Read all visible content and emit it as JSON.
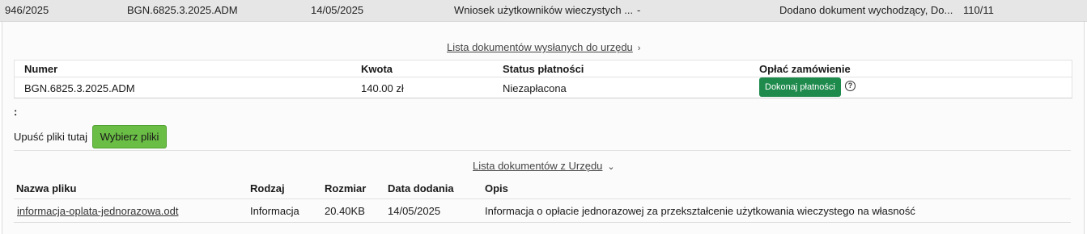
{
  "summary_row": {
    "case_number": "946/2025",
    "reference": "BGN.6825.3.2025.ADM",
    "date": "14/05/2025",
    "subject": "Wniosek użytkowników wieczystych ...",
    "dash": "-",
    "last_event": "Dodano dokument wychodzący, Do...",
    "counter": "110/11"
  },
  "sent_docs_link": "Lista dokumentów wysłanych do urzędu",
  "payments": {
    "headers": [
      "Numer",
      "Kwota",
      "Status płatności",
      "Opłać zamówienie"
    ],
    "rows": [
      {
        "number": "BGN.6825.3.2025.ADM",
        "amount": "140.00 zł",
        "status": "Niezapłacona",
        "pay_button": "Dokonaj płatności"
      }
    ],
    "help_icon": "question-circle-icon"
  },
  "colon_label": ":",
  "upload": {
    "drop_label": "Upuść pliki tutaj",
    "choose_button": "Wybierz pliki"
  },
  "office_docs_link": "Lista dokumentów z Urzędu",
  "office_docs": {
    "headers": [
      "Nazwa pliku",
      "Rodzaj",
      "Rozmiar",
      "Data dodania",
      "Opis"
    ],
    "rows": [
      {
        "file_name": "informacja-oplata-jednorazowa.odt",
        "type": "Informacja",
        "size": "20.40KB",
        "date_added": "14/05/2025",
        "description": "Informacja o opłacie jednorazowej za przekształcenie użytkowania wieczystego na własność"
      }
    ]
  },
  "colors": {
    "pay_button": "#1e8a4c",
    "choose_button": "#6abd45",
    "top_row_bg": "#e6e6e6"
  }
}
